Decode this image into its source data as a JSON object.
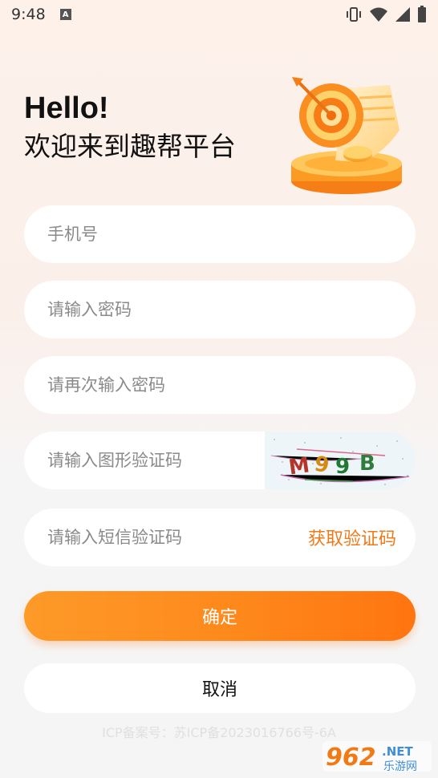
{
  "status_bar": {
    "time": "9:48",
    "badge": "A"
  },
  "greeting": {
    "hello": "Hello!",
    "welcome": "欢迎来到趣帮平台"
  },
  "form": {
    "phone_placeholder": "手机号",
    "password_placeholder": "请输入密码",
    "password_confirm_placeholder": "请再次输入密码",
    "captcha_placeholder": "请输入图形验证码",
    "captcha_image_text": [
      "M",
      "9",
      "9",
      "B"
    ],
    "sms_placeholder": "请输入短信验证码",
    "get_code_label": "获取验证码"
  },
  "buttons": {
    "confirm_label": "确定",
    "cancel_label": "取消"
  },
  "footer": {
    "icp": "ICP备案号：苏ICP备2023016766号-6A"
  },
  "watermark": {
    "number": "962",
    "net": ".NET",
    "site": "乐游网"
  },
  "colors": {
    "accent": "#ef7a18",
    "button_start": "#fd9a28",
    "button_end": "#ff7510"
  }
}
